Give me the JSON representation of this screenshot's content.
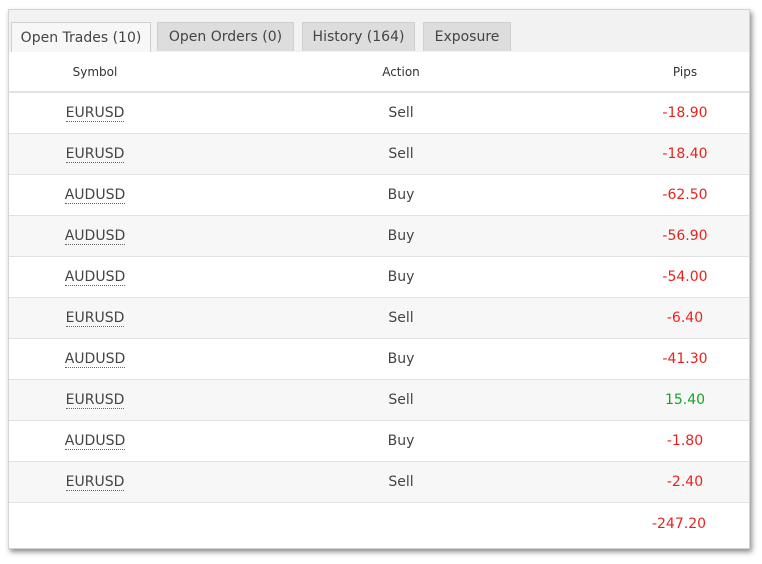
{
  "tabs": [
    {
      "label": "Open Trades (10)",
      "active": true
    },
    {
      "label": "Open Orders (0)",
      "active": false
    },
    {
      "label": "History (164)",
      "active": false
    },
    {
      "label": "Exposure",
      "active": false
    }
  ],
  "columns": {
    "symbol": "Symbol",
    "action": "Action",
    "pips": "Pips"
  },
  "rows": [
    {
      "symbol": "EURUSD",
      "action": "Sell",
      "pips": "-18.90",
      "sign": "neg"
    },
    {
      "symbol": "EURUSD",
      "action": "Sell",
      "pips": "-18.40",
      "sign": "neg"
    },
    {
      "symbol": "AUDUSD",
      "action": "Buy",
      "pips": "-62.50",
      "sign": "neg"
    },
    {
      "symbol": "AUDUSD",
      "action": "Buy",
      "pips": "-56.90",
      "sign": "neg"
    },
    {
      "symbol": "AUDUSD",
      "action": "Buy",
      "pips": "-54.00",
      "sign": "neg"
    },
    {
      "symbol": "EURUSD",
      "action": "Sell",
      "pips": "-6.40",
      "sign": "neg"
    },
    {
      "symbol": "AUDUSD",
      "action": "Buy",
      "pips": "-41.30",
      "sign": "neg"
    },
    {
      "symbol": "EURUSD",
      "action": "Sell",
      "pips": "15.40",
      "sign": "pos"
    },
    {
      "symbol": "AUDUSD",
      "action": "Buy",
      "pips": "-1.80",
      "sign": "neg"
    },
    {
      "symbol": "EURUSD",
      "action": "Sell",
      "pips": "-2.40",
      "sign": "neg"
    }
  ],
  "total": {
    "pips": "-247.20"
  },
  "colors": {
    "negative": "#e8231f",
    "positive": "#17a329",
    "text": "#444444"
  }
}
